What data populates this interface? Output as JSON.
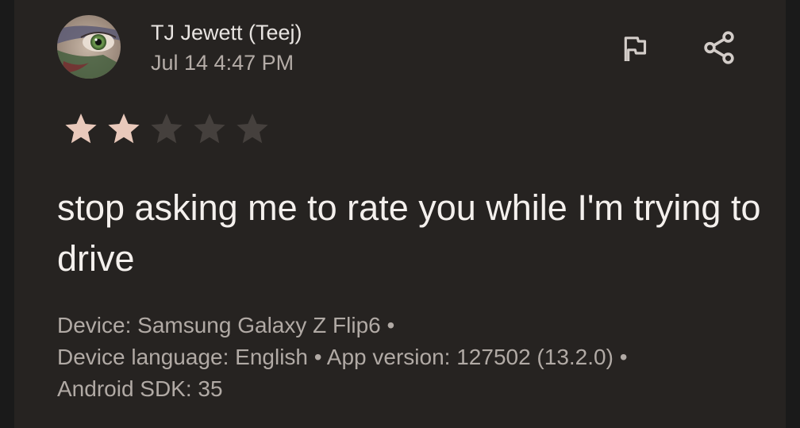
{
  "review": {
    "author": "TJ Jewett (Teej)",
    "date": "Jul 14 4:47 PM",
    "rating": 2,
    "max_rating": 5,
    "text": "stop asking me to rate you while I'm trying to drive",
    "meta": {
      "line1": "Device: Samsung Galaxy Z Flip6 •",
      "line2": "Device language: English • App version: 127502 (13.2.0) •",
      "line3": "Android SDK: 35"
    }
  },
  "icons": {
    "flag": "flag-icon",
    "share": "share-icon",
    "avatar": "avatar"
  },
  "colors": {
    "star_filled": "#e9c9bb",
    "star_empty": "#45403d",
    "background": "#262321",
    "icon": "#d3cdc9"
  }
}
